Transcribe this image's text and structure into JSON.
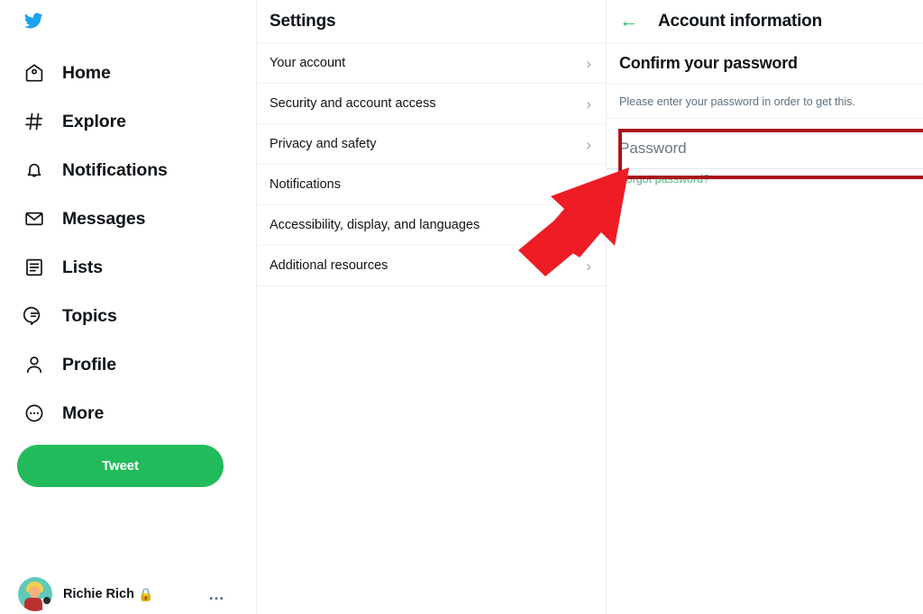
{
  "sidebar": {
    "logo": "twitter-bird-logo",
    "items": [
      {
        "label": "Home",
        "icon": "home-icon"
      },
      {
        "label": "Explore",
        "icon": "hashtag-icon"
      },
      {
        "label": "Notifications",
        "icon": "bell-icon"
      },
      {
        "label": "Messages",
        "icon": "envelope-icon"
      },
      {
        "label": "Lists",
        "icon": "list-icon"
      },
      {
        "label": "Topics",
        "icon": "speech-bubble-icon"
      },
      {
        "label": "Profile",
        "icon": "person-icon"
      },
      {
        "label": "More",
        "icon": "ellipsis-circle-icon"
      }
    ],
    "tweet_button": "Tweet",
    "profile": {
      "name": "Richie Rich",
      "lock_glyph": "🔒",
      "more_glyph": "…"
    }
  },
  "settings": {
    "title": "Settings",
    "rows": [
      {
        "label": "Your account",
        "chevron": "›"
      },
      {
        "label": "Security and account access",
        "chevron": "›"
      },
      {
        "label": "Privacy and safety",
        "chevron": "›"
      },
      {
        "label": "Notifications",
        "chevron": "›"
      },
      {
        "label": "Accessibility, display, and languages",
        "chevron": "›"
      },
      {
        "label": "Additional resources",
        "chevron": "›"
      }
    ]
  },
  "detail": {
    "back_glyph": "←",
    "title": "Account information",
    "section_title": "Confirm your password",
    "helper_text": "Please enter your password in order to get this.",
    "password_placeholder": "Password",
    "forgot_link": "Forgot password?"
  },
  "colors": {
    "twitter_blue": "#1da1f2",
    "accent_green": "#22bb5b",
    "link_green": "#53b27c",
    "annotation_red": "#ee1c25",
    "highlight_red": "#a9141a",
    "text_primary": "#0f1419",
    "text_secondary": "#5b7083"
  }
}
